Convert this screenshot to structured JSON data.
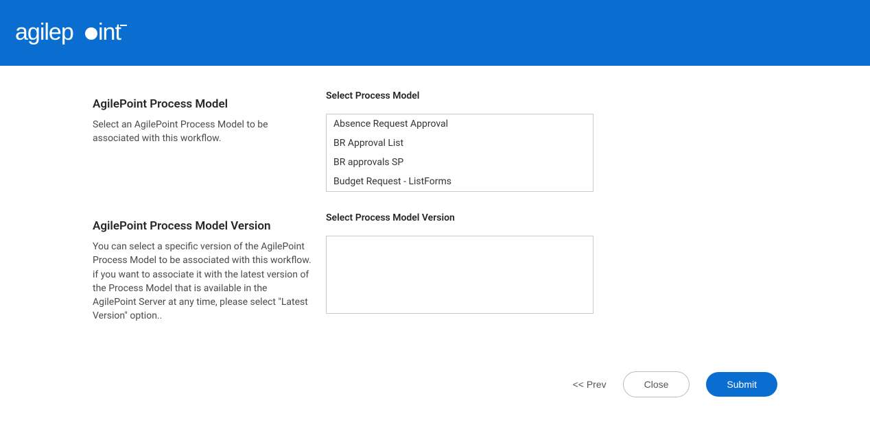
{
  "brand": {
    "name": "agilepoint"
  },
  "sections": {
    "model": {
      "title": "AgilePoint Process Model",
      "description": "Select an AgilePoint Process Model to be associated with this workflow.",
      "field_label": "Select Process Model",
      "items": [
        "Absence Request Approval",
        "BR Approval List",
        "BR approvals SP",
        "Budget Request - ListForms"
      ]
    },
    "version": {
      "title": "AgilePoint Process Model Version",
      "description": "You can select a specific version of the AgilePoint Process Model to be associated with this workflow. if you want to associate it with the latest version of the Process Model that is available in the AgilePoint Server at any time, please select \"Latest Version\" option..",
      "field_label": "Select Process Model Version"
    }
  },
  "footer": {
    "prev": "<< Prev",
    "close": "Close",
    "submit": "Submit"
  }
}
